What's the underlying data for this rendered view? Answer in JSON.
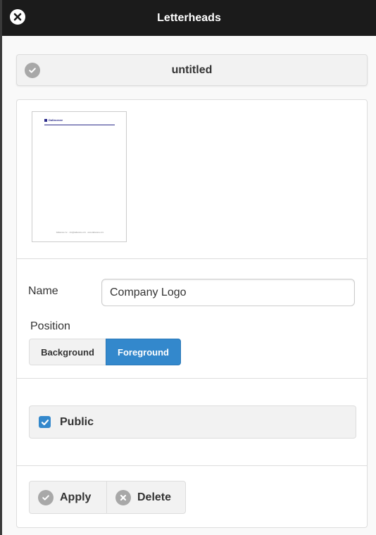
{
  "header": {
    "title": "Letterheads",
    "close_icon": "close-icon"
  },
  "document": {
    "title": "untitled",
    "status_icon": "check-circle-icon"
  },
  "preview": {
    "company_text": "Dallasrane",
    "footer_text": "Dallasrane Inc. · info@dallasrane.com · www.dallasrane.com"
  },
  "form": {
    "name_label": "Name",
    "name_value": "Company Logo",
    "position_label": "Position",
    "position_options": [
      "Background",
      "Foreground"
    ],
    "position_selected": "Foreground",
    "public_label": "Public",
    "public_checked": true
  },
  "actions": {
    "apply_label": "Apply",
    "delete_label": "Delete"
  },
  "colors": {
    "accent": "#3388cc",
    "header_bg": "#1b1b1b",
    "icon_gray": "#a8a8a8"
  }
}
